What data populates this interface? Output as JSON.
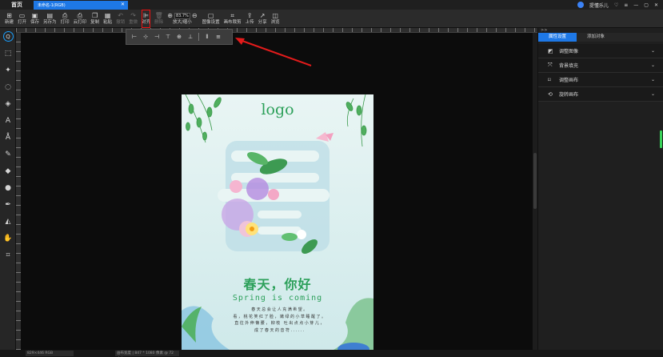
{
  "titlebar": {
    "home_tab": "首页",
    "document_tab": "未命名-1(RGB)",
    "close_symbol": "✕",
    "username": "提懂乐儿"
  },
  "toolbar": {
    "tools": [
      {
        "id": "new",
        "label": "新建",
        "icon": "new-file-icon",
        "glyph": "⊞"
      },
      {
        "id": "open",
        "label": "打开",
        "icon": "folder-icon",
        "glyph": "▭"
      },
      {
        "id": "save",
        "label": "保存",
        "icon": "save-icon",
        "glyph": "▣"
      },
      {
        "id": "save-as",
        "label": "另存为",
        "icon": "save-as-icon",
        "glyph": "▤"
      },
      {
        "id": "print",
        "label": "打印",
        "icon": "printer-icon",
        "glyph": "⎙"
      },
      {
        "id": "cloud-print",
        "label": "云打印",
        "icon": "cloud-print-icon",
        "glyph": "⎙"
      },
      {
        "id": "copy",
        "label": "复制",
        "icon": "copy-icon",
        "glyph": "❐"
      },
      {
        "id": "paste",
        "label": "粘贴",
        "icon": "paste-icon",
        "glyph": "▦"
      },
      {
        "id": "undo",
        "label": "撤销",
        "icon": "undo-icon",
        "glyph": "↶",
        "disabled": true
      },
      {
        "id": "redo",
        "label": "重做",
        "icon": "redo-icon",
        "glyph": "↷",
        "disabled": true
      },
      {
        "id": "align",
        "label": "对齐",
        "icon": "align-icon",
        "glyph": "⊫",
        "highlighted": true
      },
      {
        "id": "delete",
        "label": "删除",
        "icon": "trash-icon",
        "glyph": "🗑",
        "disabled": true
      }
    ],
    "zoom": {
      "value": "83.7%",
      "label": "放大/缩小"
    },
    "tools_right": [
      {
        "id": "image-settings",
        "label": "图像设置",
        "icon": "image-settings-icon",
        "glyph": "▢"
      },
      {
        "id": "canvas-crop",
        "label": "画布裁剪",
        "icon": "crop-icon",
        "glyph": "⌗"
      },
      {
        "id": "upload",
        "label": "上传",
        "icon": "upload-icon",
        "glyph": "⇪"
      },
      {
        "id": "share",
        "label": "分享",
        "icon": "share-icon",
        "glyph": "↗"
      },
      {
        "id": "browse",
        "label": "浏览",
        "icon": "browse-icon",
        "glyph": "◫"
      }
    ]
  },
  "left_tools": [
    {
      "id": "zoom-tool",
      "icon": "magnifier-icon",
      "glyph": "Q",
      "active": true
    },
    {
      "id": "marquee",
      "icon": "marquee-icon",
      "glyph": "⬚"
    },
    {
      "id": "magic-wand",
      "icon": "magic-wand-icon",
      "glyph": "✦"
    },
    {
      "id": "lasso",
      "icon": "lasso-icon",
      "glyph": "◌"
    },
    {
      "id": "paint-bucket",
      "icon": "paint-bucket-icon",
      "glyph": "◈"
    },
    {
      "id": "text",
      "icon": "text-tool-icon",
      "glyph": "A"
    },
    {
      "id": "pen-shape",
      "icon": "shape-text-icon",
      "glyph": "Å"
    },
    {
      "id": "brush",
      "icon": "brush-icon",
      "glyph": "✎"
    },
    {
      "id": "eraser",
      "icon": "eraser-icon",
      "glyph": "◆"
    },
    {
      "id": "stamp",
      "icon": "stamp-icon",
      "glyph": "●"
    },
    {
      "id": "pen",
      "icon": "pen-icon",
      "glyph": "✒"
    },
    {
      "id": "landscape",
      "icon": "landscape-icon",
      "glyph": "◭"
    },
    {
      "id": "hand",
      "icon": "hand-icon",
      "glyph": "✋"
    },
    {
      "id": "crop",
      "icon": "crop-tool-icon",
      "glyph": "⌗"
    }
  ],
  "align_popup": [
    {
      "id": "align-left",
      "glyph": "⊢",
      "icon": "align-left-icon"
    },
    {
      "id": "align-hcenter",
      "glyph": "⊹",
      "icon": "align-hcenter-icon"
    },
    {
      "id": "align-right",
      "glyph": "⊣",
      "icon": "align-right-icon"
    },
    {
      "id": "align-top",
      "glyph": "⊤",
      "icon": "align-top-icon"
    },
    {
      "id": "align-vcenter",
      "glyph": "⊕",
      "icon": "align-vcenter-icon"
    },
    {
      "id": "align-bottom",
      "glyph": "⊥",
      "icon": "align-bottom-icon"
    },
    {
      "id": "distribute-h",
      "glyph": "⫴",
      "icon": "distribute-horizontal-icon"
    },
    {
      "id": "distribute-v",
      "glyph": "≡",
      "icon": "distribute-vertical-icon"
    }
  ],
  "poster": {
    "logo": "logo",
    "title_cn": "春天，你好",
    "title_en": "Spring is coming",
    "body_lines": [
      "春天总会让人充满希望。",
      "看，桃花笑红了脸，嫩绿的小草睡醒了。",
      "直往外伸懒腰，柳枝        吐出点点小芽儿，",
      "成了春天的音符......"
    ]
  },
  "right_panel": {
    "collapse_symbol": ">>",
    "tabs": [
      {
        "label": "属性设置",
        "active": true
      },
      {
        "label": "添加对象",
        "active": false
      }
    ],
    "items": [
      {
        "label": "调整图像",
        "icon": "adjust-image-icon",
        "glyph": "◩"
      },
      {
        "label": "背景填充",
        "icon": "background-fill-icon",
        "glyph": "⤧"
      },
      {
        "label": "调整画布",
        "icon": "adjust-canvas-icon",
        "glyph": "⌑"
      },
      {
        "label": "旋转画布",
        "icon": "rotate-canvas-icon",
        "glyph": "⟲"
      }
    ],
    "chevron": "⌄"
  },
  "statusbar": {
    "left": "829×446 RGB",
    "mid": "画布宽度 | 847 * 1080 像素 @ 72 dpi"
  },
  "colors": {
    "accent": "#1e78e6",
    "highlight_box": "#ee1111",
    "poster_green": "#2ca05a"
  }
}
